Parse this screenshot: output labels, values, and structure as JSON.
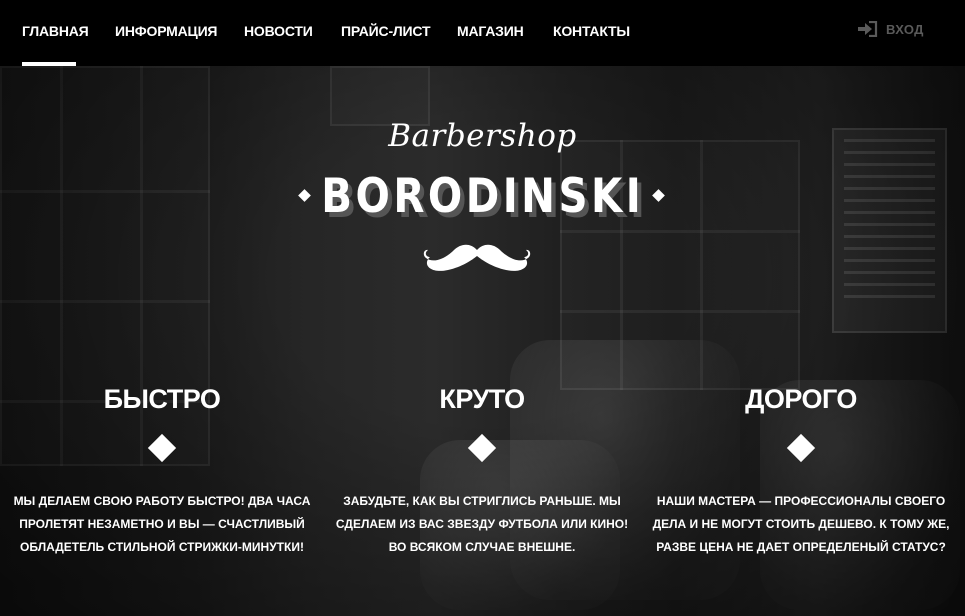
{
  "nav": {
    "items": [
      {
        "label": "ГЛАВНАЯ"
      },
      {
        "label": "ИНФОРМАЦИЯ"
      },
      {
        "label": "НОВОСТИ"
      },
      {
        "label": "ПРАЙС-ЛИСТ"
      },
      {
        "label": "МАГАЗИН"
      },
      {
        "label": "КОНТАКТЫ"
      }
    ],
    "active_index": 0,
    "login": {
      "label": "ВХОД",
      "icon": "sign-in-icon"
    }
  },
  "hero": {
    "script_title": "Barbershop",
    "brand": "BORODINSKI",
    "emblem": "mustache-icon"
  },
  "features": [
    {
      "title": "БЫСТРО",
      "text": "МЫ ДЕЛАЕМ СВОЮ РАБОТУ БЫСТРО! ДВА ЧАСА ПРОЛЕТЯТ НЕЗАМЕТНО И ВЫ — СЧАСТЛИВЫЙ ОБЛАДЕТЕЛЬ СТИЛЬНОЙ СТРИЖКИ-МИНУТКИ!"
    },
    {
      "title": "КРУТО",
      "text": "ЗАБУДЬТЕ, КАК ВЫ СТРИГЛИСЬ РАНЬШЕ. МЫ СДЕЛАЕМ ИЗ ВАС ЗВЕЗДУ ФУТБОЛА ИЛИ КИНО! ВО ВСЯКОМ СЛУЧАЕ ВНЕШНЕ."
    },
    {
      "title": "ДОРОГО",
      "text": "НАШИ МАСТЕРА — ПРОФЕССИОНАЛЫ СВОЕГО ДЕЛА И НЕ МОГУТ СТОИТЬ ДЕШЕВО. К ТОМУ ЖЕ, РАЗВЕ ЦЕНА НЕ ДАЕТ ОПРЕДЕЛЕНЫЙ СТАТУС?"
    }
  ],
  "colors": {
    "background": "#000000",
    "text": "#ffffff",
    "login_muted": "#5a5a5a"
  }
}
